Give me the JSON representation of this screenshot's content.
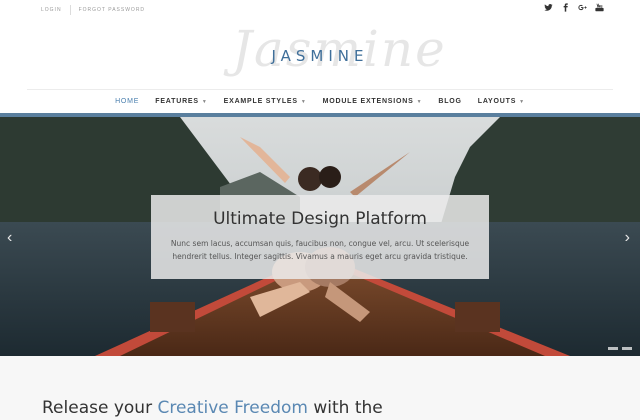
{
  "topbar": {
    "login": "LOGIN",
    "forgot_password": "FORGOT PASSWORD",
    "social": [
      "twitter-icon",
      "facebook-icon",
      "google-plus-icon",
      "youtube-icon"
    ]
  },
  "logo": {
    "script": "Jasmine",
    "text": "JASMINE"
  },
  "nav": {
    "items": [
      {
        "label": "HOME",
        "active": true,
        "dropdown": false
      },
      {
        "label": "FEATURES",
        "active": false,
        "dropdown": true
      },
      {
        "label": "EXAMPLE STYLES",
        "active": false,
        "dropdown": true
      },
      {
        "label": "MODULE EXTENSIONS",
        "active": false,
        "dropdown": true
      },
      {
        "label": "BLOG",
        "active": false,
        "dropdown": false
      },
      {
        "label": "LAYOUTS",
        "active": false,
        "dropdown": true
      }
    ]
  },
  "hero": {
    "title": "Ultimate Design Platform",
    "text": "Nunc sem lacus, accumsan quis, faucibus non, congue vel, arcu. Ut scelerisque hendrerit tellus. Integer sagittis. Vivamus a mauris eget arcu gravida tristique.",
    "prev_arrow": "‹",
    "next_arrow": "›"
  },
  "intro": {
    "heading_before": "Release your ",
    "heading_accent": "Creative Freedom",
    "heading_after": " with the"
  },
  "colors": {
    "accent": "#4a7fae",
    "nav_bar": "#5a7f9e"
  }
}
